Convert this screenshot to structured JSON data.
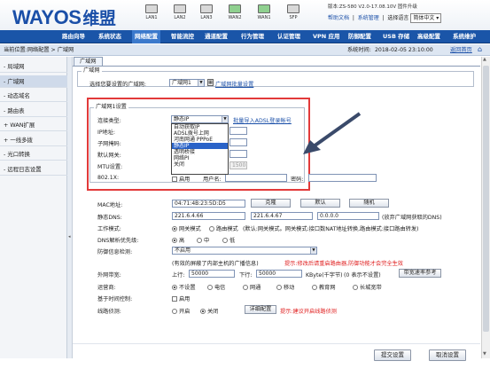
{
  "brand": {
    "logo": "WAYOS",
    "logo_cn": "维盟"
  },
  "ports": [
    {
      "label": "LAN1",
      "active": false
    },
    {
      "label": "LAN2",
      "active": false
    },
    {
      "label": "LAN3",
      "active": false
    },
    {
      "label": "WAN2",
      "active": true
    },
    {
      "label": "WAN1",
      "active": true
    },
    {
      "label": "SFP",
      "active": false
    }
  ],
  "header": {
    "version": "版本:ZS-580 V2.0-17.08.10V  固件升级",
    "help": "帮助文档",
    "sys_manage": "系统管理",
    "language_label": "选择语言",
    "language_value": "简体中文"
  },
  "nav": [
    "路由向导",
    "系统状态",
    "网络配置",
    "智能流控",
    "通道配置",
    "行为管理",
    "认证管理",
    "VPN 应用",
    "防御配置",
    "USB 存储",
    "高级配置",
    "系统维护"
  ],
  "nav_active": "网络配置",
  "breadcrumb": {
    "text": "当前位置:网络配置 > 广域网",
    "time_label": "系统时间:",
    "time": "2018-02-05 23:10:00",
    "back": "返回首页"
  },
  "sidebar": [
    {
      "label": "- 局域网",
      "active": false
    },
    {
      "label": "- 广域网",
      "active": true
    },
    {
      "label": "- 动态域名",
      "active": false
    },
    {
      "label": "- 路由表",
      "active": false
    },
    {
      "label": "+ WAN扩展",
      "active": false
    },
    {
      "label": "+ 一线多拨",
      "active": false
    },
    {
      "label": "- 光口转换",
      "active": false
    },
    {
      "label": "- 远程日志设置",
      "active": false
    }
  ],
  "tab": "广域网",
  "wan": {
    "legend": "广域网",
    "select_label": "选择您要设置的广域网:",
    "select_value": "广域网1",
    "batch_link": "广域网批量设置"
  },
  "wan1": {
    "legend": "广域网1设置",
    "conn_type_label": "连接类型:",
    "conn_type_value": "静态IP",
    "import_link": "批量导入ADSL登录帐号",
    "conn_options": [
      "自动获取IP",
      "ADSL拨号上网",
      "河南网通 PPPoE",
      "静态IP",
      "透明桥接",
      "网络PI",
      "关闭"
    ],
    "conn_highlight": "静态IP",
    "ip_label": "IP地址:",
    "mask_label": "子网掩码:",
    "gateway_label": "默认网关:",
    "mtu_label": "MTU设置:",
    "mtu_value": "1500",
    "x8021_label": "802.1X:",
    "enable_label": "启用",
    "user_label": "用户名:",
    "pass_label": "密码:"
  },
  "mac": {
    "label": "MAC地址:",
    "value": "04:71:4B:23:5D:D5",
    "clone": "克隆",
    "default": "默认",
    "random": "随机"
  },
  "dns": {
    "label": "静态DNS:",
    "dns1": "221.6.4.66",
    "dns2": "221.6.4.67",
    "dns3": "0.0.0.0",
    "note": "(放弃广域网获取的DNS)"
  },
  "mode": {
    "label": "工作模式:",
    "gateway": "网关模式",
    "route": "路由模式",
    "note": "(默认:网关模式。网关模式:接口数NAT地址转换,路由模式:接口路由转发)"
  },
  "dns_priority": {
    "label": "DNS解析优先级:",
    "high": "高",
    "mid": "中",
    "low": "低"
  },
  "defense": {
    "label": "防御信息检测:",
    "value": "不启用",
    "note_black": "(有效的屏蔽了内部主机的广播信息)",
    "note_red": "提示:修改后请重启路由器,防御功能才会完全生效"
  },
  "bandwidth": {
    "label": "外网带宽:",
    "up_label": "上行:",
    "up_value": "50000",
    "down_label": "下行:",
    "down_value": "50000",
    "unit": "KByte(千字节)",
    "note": "(0 表示不设置)",
    "ref_btn": "带宽速率参考"
  },
  "isp": {
    "label": "运营商:",
    "options": [
      "不设置",
      "电信",
      "网通",
      "移动",
      "教育网",
      "长城宽带"
    ],
    "selected": "不设置"
  },
  "time_ctrl": {
    "label": "基于时间控制:",
    "enable": "启用"
  },
  "line_check": {
    "label": "线路侦测:",
    "on": "开启",
    "off": "关闭",
    "detail_btn": "详细配置",
    "tip": "提示:建议开启线路侦测"
  },
  "footer": {
    "save": "提交设置",
    "cancel": "取消设置"
  }
}
